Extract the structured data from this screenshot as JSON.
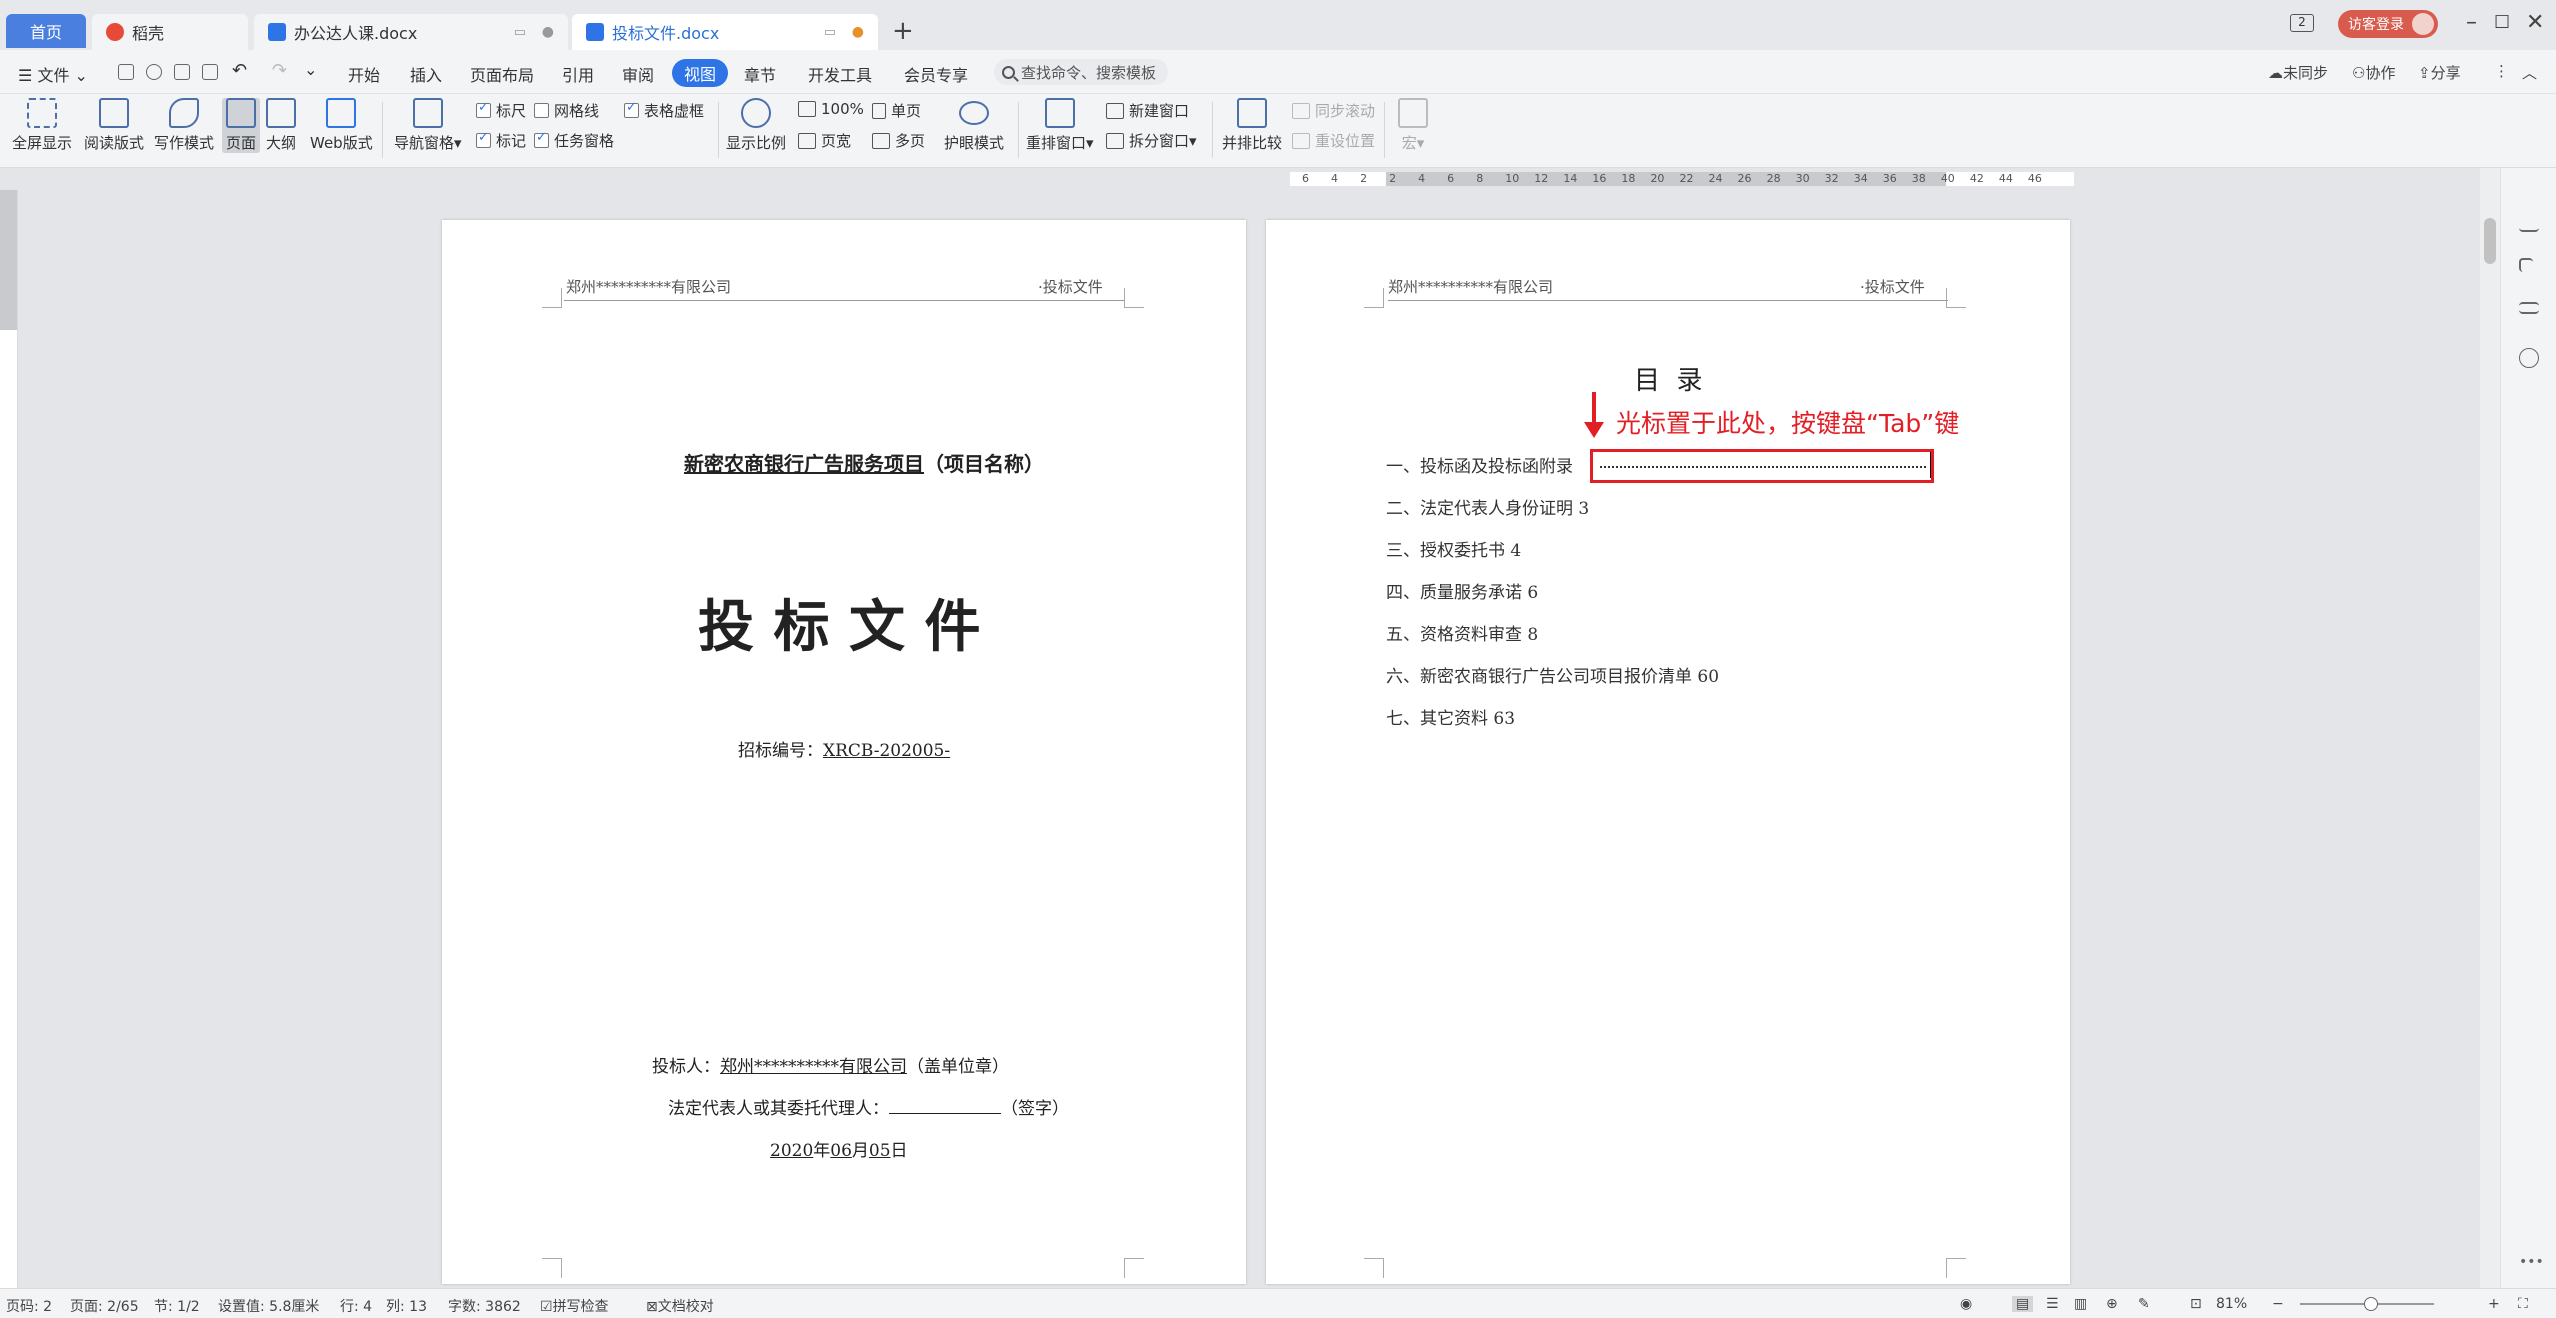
{
  "tabs": {
    "home": "首页",
    "daoke": "稻壳",
    "doc1": "办公达人课.docx",
    "doc2": "投标文件.docx",
    "new_tab": "+"
  },
  "title_right": {
    "badge": "2",
    "login": "访客登录"
  },
  "menu": {
    "file": "文件",
    "items": [
      "开始",
      "插入",
      "页面布局",
      "引用",
      "审阅",
      "视图",
      "章节",
      "开发工具",
      "会员专享"
    ],
    "active": "视图",
    "search_placeholder": "查找命令、搜索模板",
    "right": [
      "未同步",
      "协作",
      "分享"
    ]
  },
  "ribbon": {
    "fullscreen": "全屏显示",
    "read": "阅读版式",
    "write": "写作模式",
    "page": "页面",
    "outline": "大纲",
    "web": "Web版式",
    "nav": "导航窗格",
    "ruler": "标尺",
    "grid": "网格线",
    "table_frame": "表格虚框",
    "mark": "标记",
    "task_pane": "任务窗格",
    "zoom": "显示比例",
    "hundred": "100%",
    "page_width": "页宽",
    "single": "单页",
    "multi": "多页",
    "eye": "护眼模式",
    "rearrange": "重排窗口",
    "new_window": "新建窗口",
    "split": "拆分窗口",
    "compare": "并排比较",
    "sync_scroll": "同步滚动",
    "reset_pos": "重设位置",
    "macro": "宏"
  },
  "ruler_numbers": [
    "6",
    "4",
    "2",
    "2",
    "4",
    "6",
    "8",
    "10",
    "12",
    "14",
    "16",
    "18",
    "20",
    "22",
    "24",
    "26",
    "28",
    "30",
    "32",
    "34",
    "36",
    "38",
    "40",
    "42",
    "44",
    "46"
  ],
  "page1": {
    "header_left": "郑州**********有限公司",
    "header_right": "·投标文件",
    "project_name": "新密农商银行广告服务项目",
    "project_suffix": "（项目名称）",
    "title": "投 标 文 件",
    "bid_no_label": "招标编号：",
    "bid_no": "XRCB-202005-",
    "bidder_label": "投标人：",
    "bidder": "郑州**********有限公司",
    "bidder_suffix": "（盖单位章）",
    "legal_label": "法定代表人或其委托代理人：",
    "legal_suffix": "（签字）",
    "date_year": "2020",
    "date_y": "年",
    "date_month": "06",
    "date_m": "月",
    "date_day": "05",
    "date_d": "日"
  },
  "page2": {
    "header_left": "郑州**********有限公司",
    "header_right": "·投标文件",
    "toc_title": "目  录",
    "toc": [
      "一、投标函及投标函附录",
      "二、法定代表人身份证明 3",
      "三、授权委托书 4",
      "四、质量服务承诺 6",
      "五、资格资料审查 8",
      "六、新密农商银行广告公司项目报价清单 60",
      "七、其它资料 63"
    ],
    "annotation": "光标置于此处，按键盘“Tab”键"
  },
  "status": {
    "page_code": "页码: 2",
    "page": "页面: 2/65",
    "section": "节: 1/2",
    "setting": "设置值: 5.8厘米",
    "row": "行: 4",
    "col": "列: 13",
    "words": "字数: 3862",
    "spell": "拼写检查",
    "proof": "文档校对",
    "zoom": "81%"
  },
  "colors": {
    "accent": "#2f74e6",
    "annotation": "#e31f26",
    "login": "#d95b4d"
  }
}
